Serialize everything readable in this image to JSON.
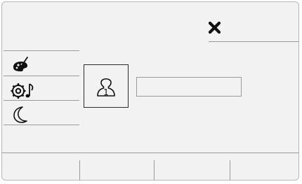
{
  "header": {
    "close_icon": "close-icon"
  },
  "sidebar": {
    "items": [
      {
        "icon": "palette-icon",
        "label": ""
      },
      {
        "icon": "sound-settings-icon",
        "label": ""
      },
      {
        "icon": "night-mode-icon",
        "label": ""
      }
    ]
  },
  "main": {
    "profile_icon": "user-profile-1-icon",
    "profile_number": "1",
    "profile_name": ""
  },
  "bottom_bar": {
    "slots": [
      "",
      "",
      "",
      ""
    ]
  },
  "colors": {
    "background": "#f2f2f2",
    "lines": "#9a9a9a",
    "icon": "#111111"
  }
}
